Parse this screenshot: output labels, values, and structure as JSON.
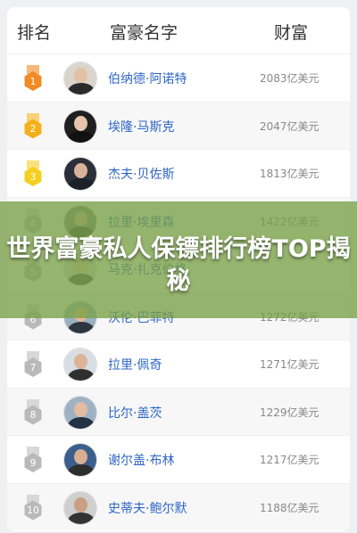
{
  "header": {
    "rank": "排名",
    "name": "富豪名字",
    "wealth": "财富"
  },
  "rows": [
    {
      "rank": "1",
      "name": "伯纳德·阿诺特",
      "wealth": "2083亿美元",
      "medal_color": "#f08a24",
      "ribbon_color": "#f7b877",
      "avatar_bg": "#d9d4cc",
      "skin": "#e4c1a5",
      "suit": "#2b2b2b"
    },
    {
      "rank": "2",
      "name": "埃隆·马斯克",
      "wealth": "2047亿美元",
      "medal_color": "#f4b01b",
      "ribbon_color": "#f7d27b",
      "avatar_bg": "#1f1f1f",
      "skin": "#e7c4ab",
      "suit": "#111111"
    },
    {
      "rank": "3",
      "name": "杰夫·贝佐斯",
      "wealth": "1813亿美元",
      "medal_color": "#f5cf1c",
      "ribbon_color": "#f8e27c",
      "avatar_bg": "#2a2f38",
      "skin": "#d9b29a",
      "suit": "#1c2027"
    },
    {
      "rank": "4",
      "name": "拉里·埃里森",
      "wealth": "1422亿美元",
      "medal_color": "#b9b9b9",
      "ribbon_color": "#d8d8d8",
      "avatar_bg": "#7a8a8e",
      "skin": "#d6ad91",
      "suit": "#3c3c3c"
    },
    {
      "rank": "5",
      "name": "马克·扎克伯格",
      "wealth": "",
      "medal_color": "#b9b9b9",
      "ribbon_color": "#d8d8d8",
      "avatar_bg": "#dcdcdc",
      "skin": "#e9c9ae",
      "suit": "#4a4a4a"
    },
    {
      "rank": "6",
      "name": "沃伦·巴菲特",
      "wealth": "1272亿美元",
      "medal_color": "#b9b9b9",
      "ribbon_color": "#d8d8d8",
      "avatar_bg": "#9ab0bf",
      "skin": "#e2b99d",
      "suit": "#2d3540"
    },
    {
      "rank": "7",
      "name": "拉里·佩奇",
      "wealth": "1271亿美元",
      "medal_color": "#b9b9b9",
      "ribbon_color": "#d8d8d8",
      "avatar_bg": "#d7dde3",
      "skin": "#ddb397",
      "suit": "#2f2f2f"
    },
    {
      "rank": "8",
      "name": "比尔·盖茨",
      "wealth": "1229亿美元",
      "medal_color": "#b9b9b9",
      "ribbon_color": "#d8d8d8",
      "avatar_bg": "#9eb2c4",
      "skin": "#e3bca1",
      "suit": "#243246"
    },
    {
      "rank": "9",
      "name": "谢尔盖·布林",
      "wealth": "1217亿美元",
      "medal_color": "#b9b9b9",
      "ribbon_color": "#d8d8d8",
      "avatar_bg": "#3b5f8c",
      "skin": "#d9ae90",
      "suit": "#2d2d2d"
    },
    {
      "rank": "10",
      "name": "史蒂夫·鲍尔默",
      "wealth": "1188亿美元",
      "medal_color": "#b9b9b9",
      "ribbon_color": "#d8d8d8",
      "avatar_bg": "#cfcfcf",
      "skin": "#c9a083",
      "suit": "#333333"
    }
  ],
  "overlay": {
    "title": "世界富豪私人保镖排行榜TOP揭秘"
  }
}
